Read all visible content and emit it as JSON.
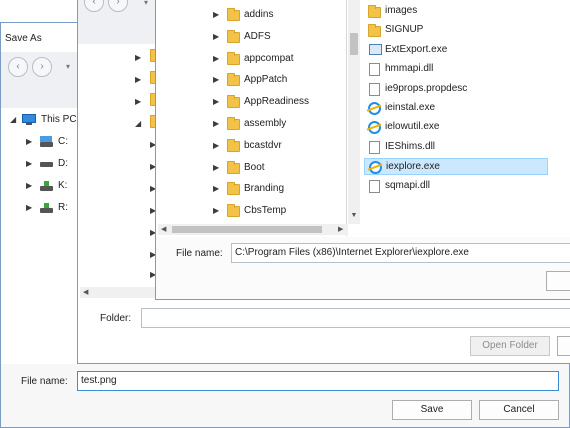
{
  "outer_dialog": {
    "title": "Save As",
    "nav": {
      "back": "‹",
      "forward": "›",
      "dropdown": "▾"
    },
    "tree": [
      {
        "label": "This PC",
        "expanded": true
      },
      {
        "label": "C:"
      },
      {
        "label": "D:"
      },
      {
        "label": "K:"
      },
      {
        "label": "R:"
      }
    ],
    "file_name_label": "File name:",
    "file_name_value": "test.png",
    "save_button": "Save",
    "cancel_button": "Cancel"
  },
  "middle_dialog": {
    "folder_label": "Folder:",
    "folder_value": "",
    "open_folder_button": "Open Folder"
  },
  "inner_dialog": {
    "folders": [
      "addins",
      "ADFS",
      "appcompat",
      "AppPatch",
      "AppReadiness",
      "assembly",
      "bcastdvr",
      "Boot",
      "Branding",
      "CbsTemp"
    ],
    "files": [
      {
        "name": "images",
        "icon": "folder-icon"
      },
      {
        "name": "SIGNUP",
        "icon": "folder-icon"
      },
      {
        "name": "ExtExport.exe",
        "icon": "exe-icon"
      },
      {
        "name": "hmmapi.dll",
        "icon": "dll-icon"
      },
      {
        "name": "ie9props.propdesc",
        "icon": "file-icon"
      },
      {
        "name": "ieinstal.exe",
        "icon": "ie-icon"
      },
      {
        "name": "ielowutil.exe",
        "icon": "ie-icon"
      },
      {
        "name": "IEShims.dll",
        "icon": "dll-icon"
      },
      {
        "name": "iexplore.exe",
        "icon": "ie-icon",
        "selected": true
      },
      {
        "name": "sqmapi.dll",
        "icon": "dll-icon"
      }
    ],
    "file_name_label": "File name:",
    "file_name_value": "C:\\Program Files (x86)\\Internet Explorer\\iexplore.exe"
  },
  "colors": {
    "selection_bg": "#cce8ff",
    "selection_border": "#99d1ff",
    "window_border": "#7a9cc4",
    "toolbar_gray": "#eef0f3"
  }
}
